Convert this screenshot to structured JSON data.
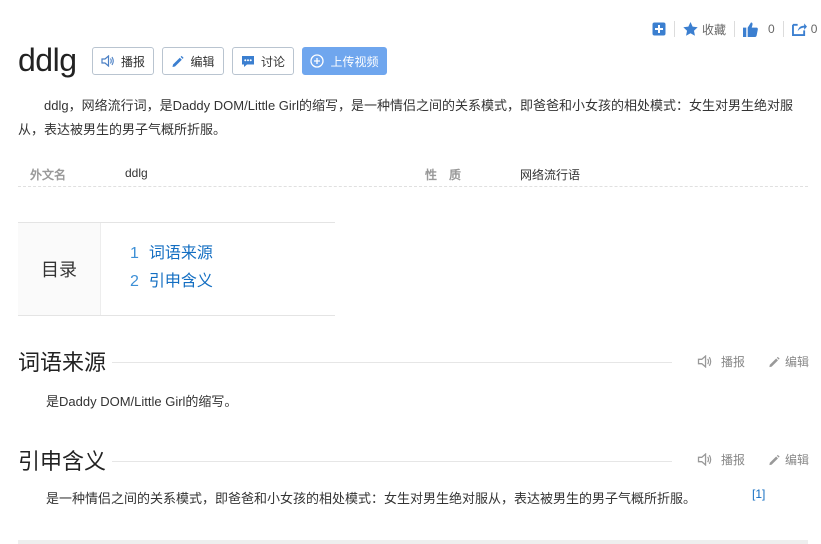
{
  "toolbar": {
    "collect_label": "收藏",
    "like_count": "0",
    "share_count": "0"
  },
  "title": "ddlg",
  "buttons": {
    "broadcast": "播报",
    "edit": "编辑",
    "discuss": "讨论",
    "upload": "上传视频"
  },
  "summary": "ddlg，网络流行词，是Daddy DOM/Little Girl的缩写，是一种情侣之间的关系模式，即爸爸和小女孩的相处模式：女生对男生绝对服从，表达被男生的男子气概所折服。",
  "basic_info": [
    {
      "key": "外文名",
      "value": "ddlg"
    },
    {
      "key": "性　质",
      "value": "网络流行语"
    }
  ],
  "catalog": {
    "title": "目录",
    "items": [
      {
        "num": "1",
        "label": "词语来源"
      },
      {
        "num": "2",
        "label": "引申含义"
      }
    ]
  },
  "sections": [
    {
      "title": "词语来源",
      "broadcast": "播报",
      "edit": "编辑",
      "text": "是Daddy DOM/Little Girl的缩写。"
    },
    {
      "title": "引申含义",
      "broadcast": "播报",
      "edit": "编辑",
      "text": "是一种情侣之间的关系模式，即爸爸和小女孩的相处模式：女生对男生绝对服从，表达被男生的男子气概所折服。",
      "ref": "[1]"
    }
  ],
  "colors": {
    "accent": "#3b7fd0",
    "link": "#136ec2",
    "upload_bg": "#6fa6ee"
  },
  "icons": [
    "plus-square-icon",
    "star-icon",
    "thumbs-up-icon",
    "share-icon",
    "speaker-icon",
    "pencil-icon",
    "chat-icon",
    "plus-circle-icon"
  ]
}
